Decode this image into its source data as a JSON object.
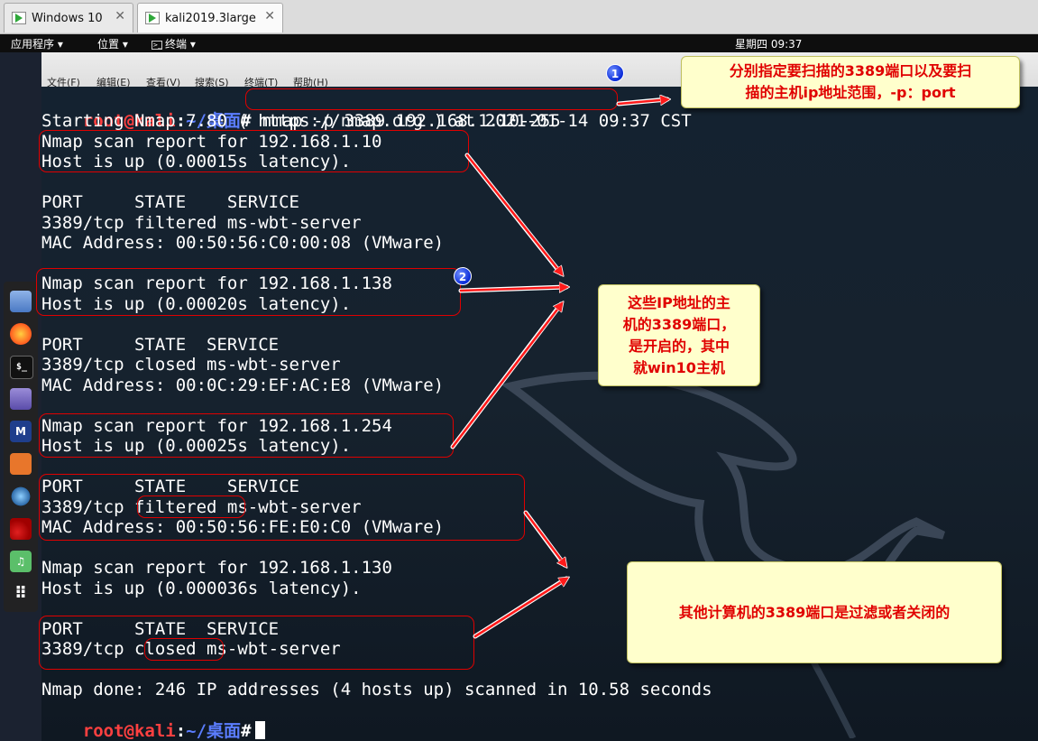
{
  "vm_tabs": [
    {
      "label": "Windows 10",
      "close": "✕"
    },
    {
      "label": "kali2019.3large",
      "close": "✕"
    }
  ],
  "topbar": {
    "apps": "应用程序 ▾",
    "places": "位置 ▾",
    "terminal": "终端 ▾",
    "clock": "星期四 09:37"
  },
  "terminal_menu": [
    "文件(F)",
    "编辑(E)",
    "查看(V)",
    "搜索(S)",
    "终端(T)",
    "帮助(H)"
  ],
  "prompt": {
    "user": "root@kali",
    "colon": ":",
    "path": "~/桌面",
    "hash": "#"
  },
  "command": " nmap -p 3389 192.168.1.10-255",
  "output": [
    "Starting Nmap 7.80 ( https://nmap.org ) at 2021-01-14 09:37 CST",
    "Nmap scan report for 192.168.1.10",
    "Host is up (0.00015s latency).",
    "",
    "PORT     STATE    SERVICE",
    "3389/tcp filtered ms-wbt-server",
    "MAC Address: 00:50:56:C0:00:08 (VMware)",
    "",
    "Nmap scan report for 192.168.1.138",
    "Host is up (0.00020s latency).",
    "",
    "PORT     STATE  SERVICE",
    "3389/tcp closed ms-wbt-server",
    "MAC Address: 00:0C:29:EF:AC:E8 (VMware)",
    "",
    "Nmap scan report for 192.168.1.254",
    "Host is up (0.00025s latency).",
    "",
    "PORT     STATE    SERVICE",
    "3389/tcp filtered ms-wbt-server",
    "MAC Address: 00:50:56:FE:E0:C0 (VMware)",
    "",
    "Nmap scan report for 192.168.1.130",
    "Host is up (0.000036s latency).",
    "",
    "PORT     STATE  SERVICE",
    "3389/tcp closed ms-wbt-server",
    "",
    "Nmap done: 246 IP addresses (4 hosts up) scanned in 10.58 seconds"
  ],
  "dock": [
    {
      "icon": "files-icon",
      "glyph": ""
    },
    {
      "icon": "firefox-icon",
      "glyph": ""
    },
    {
      "icon": "terminal-icon",
      "glyph": "$_"
    },
    {
      "icon": "text-editor-icon",
      "glyph": ""
    },
    {
      "icon": "metasploit-icon",
      "glyph": "M"
    },
    {
      "icon": "burpsuite-icon",
      "glyph": ""
    },
    {
      "icon": "eye-icon",
      "glyph": ""
    },
    {
      "icon": "cherrytree-icon",
      "glyph": ""
    },
    {
      "icon": "music-icon",
      "glyph": "♫"
    },
    {
      "icon": "app-grid-icon",
      "glyph": "⠿"
    }
  ],
  "annotations": {
    "badge1": "1",
    "badge2": "2",
    "note1_l1": "分别指定要扫描的3389端口以及要扫",
    "note1_l2": "描的主机ip地址范围，-p：port",
    "note2_l1": "这些IP地址的主",
    "note2_l2": "机的3389端口，",
    "note2_l3": "是开启的，其中",
    "note2_l4": "就win10主机",
    "note3": "其他计算机的3389端口是过滤或者关闭的"
  },
  "colors": {
    "annotation_red": "#e00000",
    "note_bg": "#ffffcc",
    "prompt_user": "#ff4040",
    "prompt_path": "#5b7dff"
  }
}
